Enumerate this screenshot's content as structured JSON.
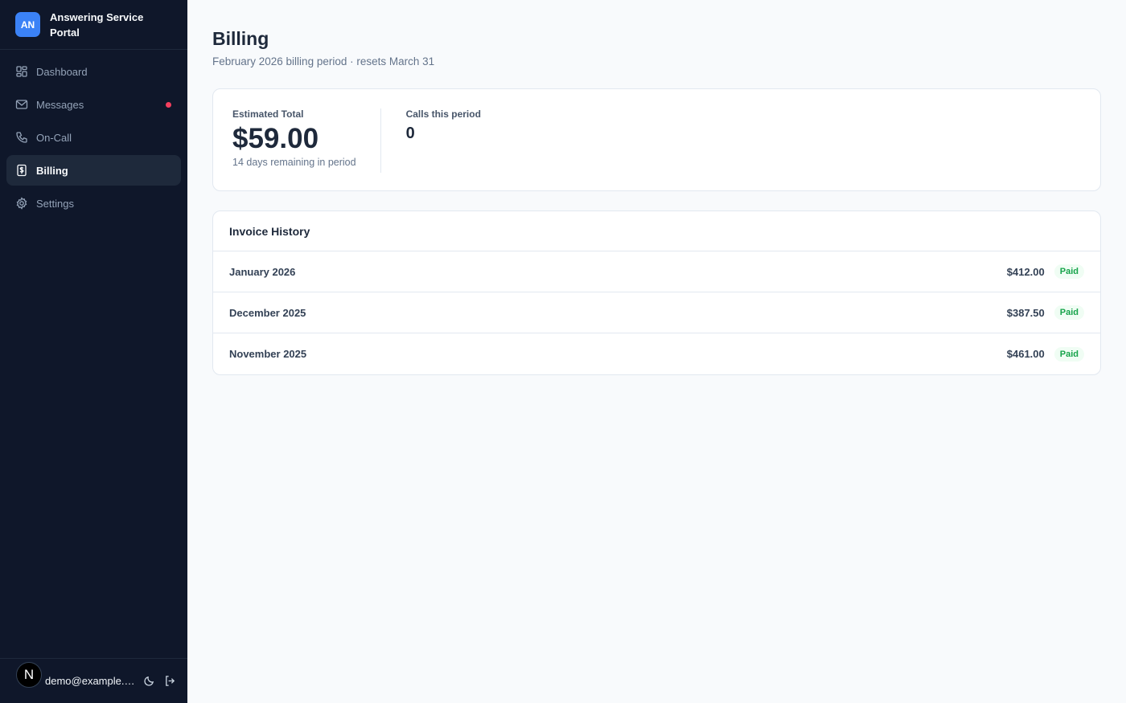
{
  "brand": {
    "initials": "AN",
    "title": "Answering Service Portal",
    "badge_color": "#3b82f6"
  },
  "nav": {
    "items": [
      {
        "label": "Dashboard",
        "icon": "grid-icon"
      },
      {
        "label": "Messages",
        "icon": "mail-icon",
        "has_unread_dot": true
      },
      {
        "label": "On-Call",
        "icon": "phone-icon"
      },
      {
        "label": "Billing",
        "icon": "dollar-icon",
        "active": true
      },
      {
        "label": "Settings",
        "icon": "gear-icon"
      }
    ]
  },
  "footer": {
    "avatar_letter": "N",
    "email": "demo@example.com",
    "theme_icon": "moon-icon",
    "logout_icon": "logout-icon"
  },
  "page": {
    "title": "Billing",
    "subtitle": "February 2026 billing period · resets March 31"
  },
  "summary": {
    "estimated_label": "Estimated Total",
    "estimated_value": "$59.00",
    "estimated_note": "14 days remaining in period",
    "calls_label": "Calls this period",
    "calls_value": "0"
  },
  "invoices": {
    "title": "Invoice History",
    "rows": [
      {
        "month": "January 2026",
        "amount": "$412.00",
        "status": "Paid"
      },
      {
        "month": "December 2025",
        "amount": "$387.50",
        "status": "Paid"
      },
      {
        "month": "November 2025",
        "amount": "$461.00",
        "status": "Paid"
      }
    ]
  },
  "colors": {
    "sidebar_bg": "#0f172a",
    "accent": "#3b82f6",
    "paid": "#16a34a",
    "unread_dot": "#f43f5e"
  }
}
